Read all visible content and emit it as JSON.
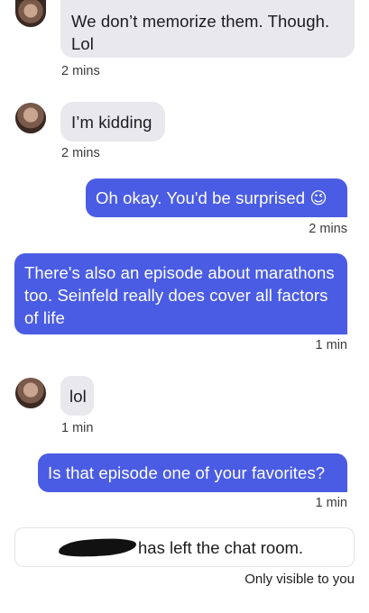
{
  "messages": [
    {
      "from": "other",
      "text": "We don’t memorize them. Though. Lol",
      "time": "2 mins"
    },
    {
      "from": "other",
      "text": "I’m kidding",
      "time": "2 mins"
    },
    {
      "from": "me",
      "text": "Oh okay. You'd be surprised 😉",
      "time": "2 mins"
    },
    {
      "from": "me",
      "text": "There's also an episode about marathons too. Seinfeld really does cover all factors of life",
      "time": "1 min"
    },
    {
      "from": "other",
      "text": "lol",
      "time": "1 min"
    },
    {
      "from": "me",
      "text": "Is that episode one of your favorites?",
      "time": "1 min"
    }
  ],
  "system_notice": {
    "text": "has left the chat room.",
    "visibility": "Only visible to you"
  },
  "colors": {
    "outgoing_bubble": "#4a5ce3",
    "incoming_bubble": "#e8e8ed",
    "redaction": "#111111"
  },
  "icons": [
    "avatar",
    "redaction-scribble"
  ]
}
